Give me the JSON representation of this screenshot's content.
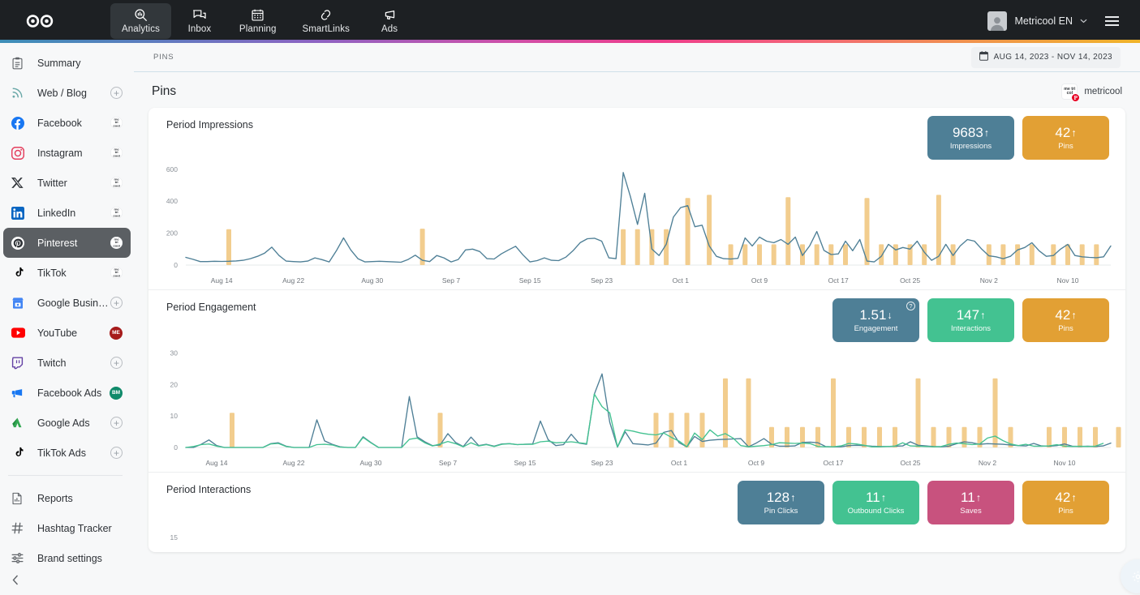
{
  "topnav": {
    "logo_name": "metricool-logo",
    "items": [
      {
        "label": "Analytics",
        "icon": "analytics-icon",
        "active": true
      },
      {
        "label": "Inbox",
        "icon": "inbox-icon",
        "active": false
      },
      {
        "label": "Planning",
        "icon": "calendar-icon",
        "active": false
      },
      {
        "label": "SmartLinks",
        "icon": "link-icon",
        "active": false
      },
      {
        "label": "Ads",
        "icon": "megaphone-icon",
        "active": false
      }
    ],
    "account_name": "Metricool EN",
    "caret": "∨"
  },
  "sidebar": {
    "items": [
      {
        "label": "Summary",
        "icon": "clipboard-icon",
        "badge": "none"
      },
      {
        "label": "Web / Blog",
        "icon": "rss-icon",
        "badge": "plus"
      },
      {
        "label": "Facebook",
        "icon": "facebook-icon",
        "badge": "brand"
      },
      {
        "label": "Instagram",
        "icon": "instagram-icon",
        "badge": "brand"
      },
      {
        "label": "Twitter",
        "icon": "twitter-x-icon",
        "badge": "brand"
      },
      {
        "label": "LinkedIn",
        "icon": "linkedin-icon",
        "badge": "brand"
      },
      {
        "label": "Pinterest",
        "icon": "pinterest-icon",
        "badge": "brand",
        "active": true
      },
      {
        "label": "TikTok",
        "icon": "tiktok-icon",
        "badge": "brand"
      },
      {
        "label": "Google Business ...",
        "icon": "google-business-icon",
        "badge": "plus"
      },
      {
        "label": "YouTube",
        "icon": "youtube-icon",
        "badge": "initials",
        "initials": "ME",
        "badge_color": "#a61b1b"
      },
      {
        "label": "Twitch",
        "icon": "twitch-icon",
        "badge": "plus"
      },
      {
        "label": "Facebook Ads",
        "icon": "facebook-ads-icon",
        "badge": "initials",
        "initials": "BM",
        "badge_color": "#0f8a6a"
      },
      {
        "label": "Google Ads",
        "icon": "google-ads-icon",
        "badge": "plus"
      },
      {
        "label": "TikTok Ads",
        "icon": "tiktok-ads-icon",
        "badge": "plus"
      }
    ],
    "tools": [
      {
        "label": "Reports",
        "icon": "report-icon"
      },
      {
        "label": "Hashtag Tracker",
        "icon": "hashtag-icon"
      },
      {
        "label": "Brand settings",
        "icon": "sliders-icon"
      }
    ],
    "collapse_label": "‹",
    "brand_badge_text": "me tri cool"
  },
  "main": {
    "breadcrumb": "PINS",
    "date_range": "AUG 14, 2023 - NOV 14, 2023",
    "page_title": "Pins",
    "brand_label": "metricool",
    "brand_badge_text": "me tri col"
  },
  "blocks": [
    {
      "title": "Period Impressions",
      "cards": [
        {
          "value": "9683",
          "arrow": "↑",
          "label": "Impressions",
          "color": "#4e7f96"
        },
        {
          "value": "42",
          "arrow": "↑",
          "label": "Pins",
          "color": "#e2a034"
        }
      ]
    },
    {
      "title": "Period Engagement",
      "cards": [
        {
          "value": "1.51",
          "arrow": "↓",
          "label": "Engagement",
          "color": "#4e7f96",
          "help": true
        },
        {
          "value": "147",
          "arrow": "↑",
          "label": "Interactions",
          "color": "#43c291"
        },
        {
          "value": "42",
          "arrow": "↑",
          "label": "Pins",
          "color": "#e2a034"
        }
      ]
    },
    {
      "title": "Period Interactions",
      "cards": [
        {
          "value": "128",
          "arrow": "↑",
          "label": "Pin Clicks",
          "color": "#4e7f96"
        },
        {
          "value": "11",
          "arrow": "↑",
          "label": "Outbound Clicks",
          "color": "#43c291"
        },
        {
          "value": "11",
          "arrow": "↑",
          "label": "Saves",
          "color": "#c8527e"
        },
        {
          "value": "42",
          "arrow": "↑",
          "label": "Pins",
          "color": "#e2a034"
        }
      ]
    }
  ],
  "chart_data": [
    {
      "type": "line",
      "title": "Period Impressions",
      "xlabel": "",
      "ylabel": "",
      "ylim": [
        0,
        650
      ],
      "yticks": [
        0,
        200,
        400,
        600
      ],
      "grid": false,
      "xticks": [
        "Aug 14",
        "Aug 22",
        "Aug 30",
        "Sep 7",
        "Sep 15",
        "Sep 23",
        "Oct 1",
        "Oct 9",
        "Oct 17",
        "Oct 25",
        "Nov 2",
        "Nov 10"
      ],
      "xtick_indices": [
        0,
        8,
        16,
        24,
        32,
        40,
        48,
        56,
        64,
        72,
        80,
        88
      ],
      "legend": [
        "Impressions",
        "Pins"
      ],
      "series": [
        {
          "name": "Impressions",
          "color": "#4e7f96",
          "type": "line",
          "values": [
            48,
            36,
            22,
            22,
            24,
            23,
            24,
            26,
            30,
            40,
            55,
            75,
            112,
            60,
            25,
            22,
            20,
            25,
            45,
            34,
            20,
            90,
            170,
            95,
            40,
            20,
            22,
            24,
            22,
            20,
            18,
            35,
            62,
            30,
            22,
            60,
            45,
            20,
            35,
            95,
            100,
            85,
            40,
            38,
            70,
            95,
            118,
            65,
            20,
            28,
            45,
            30,
            28,
            50,
            90,
            140,
            165,
            168,
            150,
            45,
            40,
            580,
            430,
            255,
            450,
            100,
            60,
            130,
            300,
            360,
            372,
            240,
            250,
            120,
            55,
            40,
            38,
            42,
            170,
            120,
            175,
            150,
            140,
            160,
            130,
            175,
            60,
            120,
            210,
            92,
            66,
            70,
            150,
            90,
            160,
            25,
            20,
            55,
            130,
            95,
            110,
            100,
            150,
            80,
            30,
            55,
            130,
            60,
            120,
            160,
            150,
            100,
            58,
            52,
            40,
            55,
            95,
            110,
            140,
            90,
            55,
            60,
            100,
            130,
            60,
            52,
            48,
            46,
            52,
            120
          ]
        },
        {
          "name": "Pins",
          "color": "#f2cd8e",
          "type": "bar",
          "bars": [
            {
              "i": 6,
              "v": 225
            },
            {
              "i": 33,
              "v": 228
            },
            {
              "i": 61,
              "v": 225
            },
            {
              "i": 63,
              "v": 225
            },
            {
              "i": 65,
              "v": 225
            },
            {
              "i": 67,
              "v": 225
            },
            {
              "i": 70,
              "v": 420
            },
            {
              "i": 73,
              "v": 440
            },
            {
              "i": 76,
              "v": 130
            },
            {
              "i": 78,
              "v": 130
            },
            {
              "i": 80,
              "v": 130
            },
            {
              "i": 82,
              "v": 130
            },
            {
              "i": 84,
              "v": 425
            },
            {
              "i": 86,
              "v": 130
            },
            {
              "i": 88,
              "v": 130
            },
            {
              "i": 90,
              "v": 130
            },
            {
              "i": 92,
              "v": 130
            },
            {
              "i": 95,
              "v": 420
            },
            {
              "i": 97,
              "v": 130
            },
            {
              "i": 99,
              "v": 130
            },
            {
              "i": 101,
              "v": 130
            },
            {
              "i": 103,
              "v": 130
            },
            {
              "i": 105,
              "v": 440
            },
            {
              "i": 107,
              "v": 130
            },
            {
              "i": 112,
              "v": 130
            },
            {
              "i": 114,
              "v": 130
            },
            {
              "i": 116,
              "v": 130
            },
            {
              "i": 118,
              "v": 130
            },
            {
              "i": 121,
              "v": 130
            },
            {
              "i": 123,
              "v": 130
            },
            {
              "i": 125,
              "v": 130
            },
            {
              "i": 127,
              "v": 130
            },
            {
              "i": 133,
              "v": 130
            }
          ]
        }
      ]
    },
    {
      "type": "line",
      "title": "Period Engagement",
      "xlabel": "",
      "ylabel": "",
      "ylim": [
        0,
        33
      ],
      "yticks": [
        0,
        10,
        20,
        30
      ],
      "grid": false,
      "xticks": [
        "Aug 14",
        "Aug 22",
        "Aug 30",
        "Sep 7",
        "Sep 15",
        "Sep 23",
        "Oct 1",
        "Oct 9",
        "Oct 17",
        "Oct 25",
        "Nov 2",
        "Nov 10"
      ],
      "legend": [
        "Interactions",
        "Engagement",
        "Pins"
      ],
      "series": [
        {
          "name": "Engagement",
          "color": "#4e7f96",
          "type": "line",
          "values": [
            0,
            0,
            1,
            2.4,
            0.6,
            0,
            0,
            0,
            0,
            0,
            0,
            1.2,
            1.5,
            0.4,
            0,
            0,
            0,
            8.8,
            2.1,
            1,
            0.2,
            0,
            0,
            3.4,
            1.6,
            0,
            0,
            0,
            0,
            16.2,
            3.4,
            1.8,
            0.6,
            0.8,
            4.4,
            1.6,
            0.3,
            3.3,
            0.6,
            1,
            0.4,
            1.1,
            1.2,
            0.9,
            1,
            1.1,
            8.4,
            2.5,
            0.6,
            0.9,
            4.2,
            1.4,
            1,
            17,
            23.4,
            8,
            0.1,
            5,
            1.2,
            1,
            0.8,
            1.4,
            4.8,
            5.4,
            1.5,
            0.2,
            3.5,
            1.9,
            2.3,
            2.5,
            2.6,
            2.7,
            2.8,
            0.2,
            1.4,
            2.8,
            1,
            0.4,
            0.4,
            0.5,
            1.6,
            1.7,
            1.5,
            0.3,
            0.2,
            0.2,
            0.6,
            0.7,
            0.6,
            0.4,
            0.3,
            0.3,
            0.4,
            0.5,
            1.8,
            0.7,
            0.5,
            0.3,
            0.2,
            0.4,
            1.2,
            1.8,
            1.5,
            1,
            1.2,
            1.1,
            1,
            0.8,
            0.6,
            0.5,
            1.3,
            0.5,
            0.4,
            0.6,
            1.1,
            0.4,
            0.3,
            0.4,
            0.3,
            0.5,
            1.4
          ]
        },
        {
          "name": "Interactions",
          "color": "#43c291",
          "type": "line",
          "values": [
            0,
            0.3,
            0.9,
            1.1,
            0.4,
            0,
            0,
            0,
            0,
            0,
            0,
            1.1,
            1.3,
            0.3,
            0,
            0,
            0,
            0.9,
            1,
            0.8,
            0.1,
            0,
            0,
            3.2,
            1.5,
            0,
            0,
            0,
            0,
            2.6,
            3,
            1.5,
            0.5,
            1.1,
            1.9,
            1.2,
            0.2,
            1.5,
            0.5,
            0.9,
            0.3,
            1,
            1.2,
            0.9,
            1,
            1,
            1.8,
            2,
            1.5,
            1.6,
            1.8,
            1.5,
            1.2,
            17,
            13,
            11,
            0.2,
            5.6,
            5.2,
            4.6,
            4.2,
            4,
            4.6,
            3.2,
            2,
            0.2,
            4.6,
            2.5,
            5.6,
            3.6,
            4.4,
            3,
            0.6,
            0.2,
            0.4,
            0.6,
            0.9,
            1.5,
            1.4,
            1.3,
            1.4,
            1.2,
            0.3,
            0.2,
            0.2,
            0.5,
            1.3,
            1.1,
            0.7,
            0.2,
            0.2,
            0.3,
            0.4,
            1.5,
            0.5,
            0.4,
            0.3,
            0.2,
            0.3,
            1,
            1.4,
            1.2,
            0.9,
            1.1,
            3,
            3.6,
            2.2,
            1.1,
            0.6,
            1,
            0.4,
            0.4,
            0.5,
            0.9,
            0.4,
            0.3,
            0.4,
            0.3,
            0.4,
            1.3
          ]
        },
        {
          "name": "Pins",
          "color": "#f2cd8e",
          "type": "bar",
          "bars": [
            {
              "i": 6,
              "v": 11
            },
            {
              "i": 33,
              "v": 11
            },
            {
              "i": 61,
              "v": 11
            },
            {
              "i": 63,
              "v": 11
            },
            {
              "i": 65,
              "v": 11
            },
            {
              "i": 67,
              "v": 11
            },
            {
              "i": 70,
              "v": 22
            },
            {
              "i": 73,
              "v": 22
            },
            {
              "i": 76,
              "v": 6.5
            },
            {
              "i": 78,
              "v": 6.5
            },
            {
              "i": 80,
              "v": 6.5
            },
            {
              "i": 82,
              "v": 6.5
            },
            {
              "i": 84,
              "v": 22
            },
            {
              "i": 86,
              "v": 6.5
            },
            {
              "i": 88,
              "v": 6.5
            },
            {
              "i": 90,
              "v": 6.5
            },
            {
              "i": 92,
              "v": 6.5
            },
            {
              "i": 95,
              "v": 22
            },
            {
              "i": 97,
              "v": 6.5
            },
            {
              "i": 99,
              "v": 6.5
            },
            {
              "i": 101,
              "v": 6.5
            },
            {
              "i": 103,
              "v": 6.5
            },
            {
              "i": 105,
              "v": 22
            },
            {
              "i": 107,
              "v": 6.5
            },
            {
              "i": 112,
              "v": 6.5
            },
            {
              "i": 114,
              "v": 6.5
            },
            {
              "i": 116,
              "v": 6.5
            },
            {
              "i": 118,
              "v": 6.5
            },
            {
              "i": 121,
              "v": 6.5
            },
            {
              "i": 123,
              "v": 6.5
            },
            {
              "i": 125,
              "v": 6.5
            },
            {
              "i": 127,
              "v": 6.5
            },
            {
              "i": 133,
              "v": 6.5
            }
          ]
        }
      ]
    },
    {
      "type": "line",
      "title": "Period Interactions",
      "ylim": [
        0,
        16
      ],
      "yticks": [
        15
      ],
      "grid": false,
      "xticks": [],
      "legend": [
        "Pin Clicks",
        "Outbound Clicks",
        "Saves",
        "Pins"
      ],
      "series": []
    }
  ]
}
